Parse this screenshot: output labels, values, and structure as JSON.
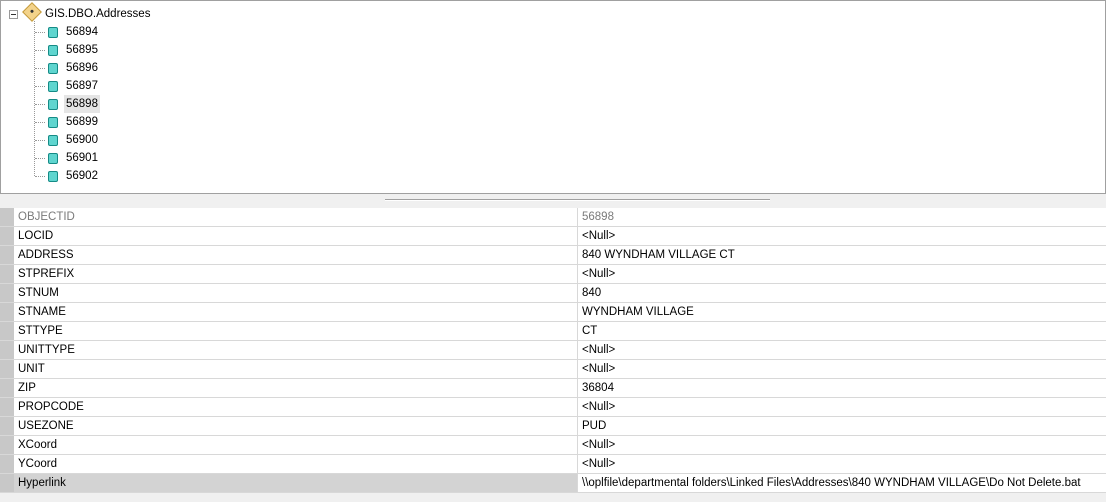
{
  "tree": {
    "root": "GIS.DBO.Addresses",
    "items": [
      "56894",
      "56895",
      "56896",
      "56897",
      "56898",
      "56899",
      "56900",
      "56901",
      "56902"
    ],
    "selected": "56898"
  },
  "fields": [
    {
      "name": "OBJECTID",
      "value": "56898",
      "readonly": true
    },
    {
      "name": "LOCID",
      "value": "<Null>"
    },
    {
      "name": "ADDRESS",
      "value": "840 WYNDHAM VILLAGE CT"
    },
    {
      "name": "STPREFIX",
      "value": "<Null>"
    },
    {
      "name": "STNUM",
      "value": "840"
    },
    {
      "name": "STNAME",
      "value": "WYNDHAM VILLAGE"
    },
    {
      "name": "STTYPE",
      "value": "CT"
    },
    {
      "name": "UNITTYPE",
      "value": "<Null>"
    },
    {
      "name": "UNIT",
      "value": "<Null>"
    },
    {
      "name": "ZIP",
      "value": "36804"
    },
    {
      "name": "PROPCODE",
      "value": "<Null>"
    },
    {
      "name": "USEZONE",
      "value": "PUD"
    },
    {
      "name": "XCoord",
      "value": "<Null>"
    },
    {
      "name": "YCoord",
      "value": "<Null>"
    },
    {
      "name": "Hyperlink",
      "value": "\\\\oplfile\\departmental folders\\Linked Files\\Addresses\\840 WYNDHAM VILLAGE\\Do Not Delete.bat",
      "active": true
    }
  ]
}
